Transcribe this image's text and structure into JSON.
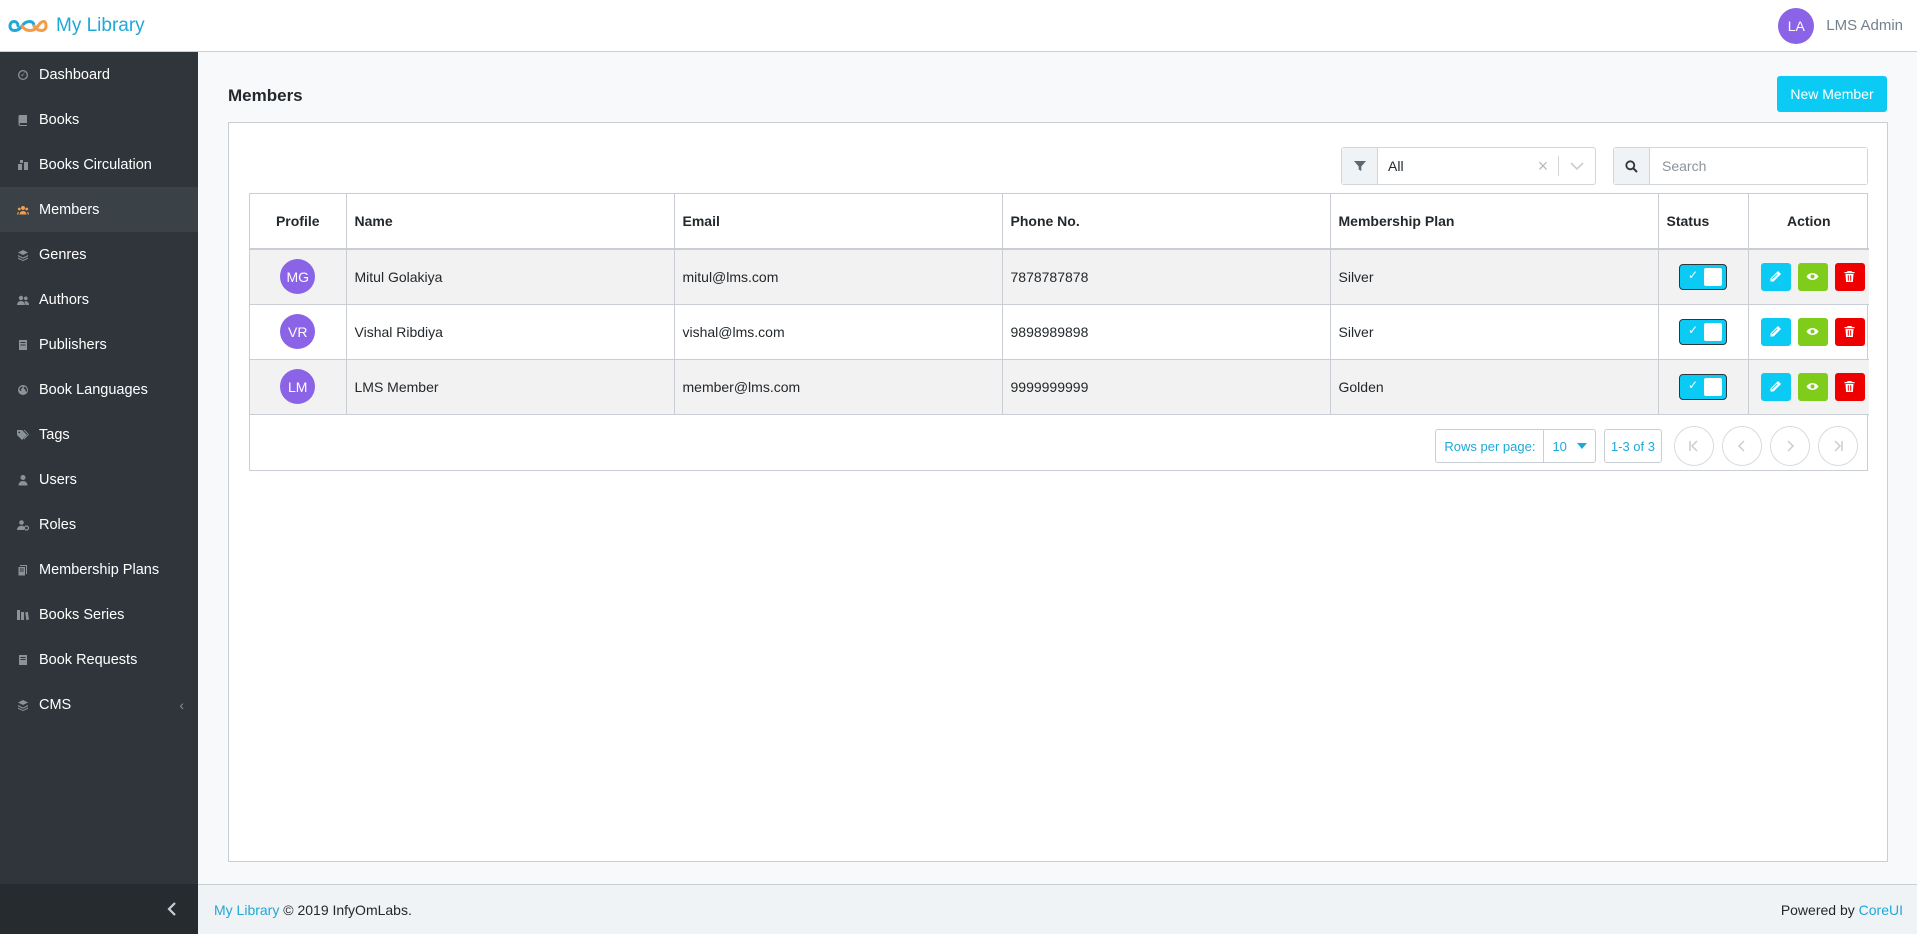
{
  "header": {
    "brand_name": "My Library",
    "logo_icon": "infinity-logo-icon",
    "user_initials": "LA",
    "user_name": "LMS Admin"
  },
  "sidebar": {
    "items": [
      {
        "label": "Dashboard",
        "icon": "speedometer-icon"
      },
      {
        "label": "Books",
        "icon": "book-icon"
      },
      {
        "label": "Books Circulation",
        "icon": "circulation-icon"
      },
      {
        "label": "Members",
        "icon": "users-group-icon"
      },
      {
        "label": "Genres",
        "icon": "layers-icon"
      },
      {
        "label": "Authors",
        "icon": "user-friends-icon"
      },
      {
        "label": "Publishers",
        "icon": "book-stack-icon"
      },
      {
        "label": "Book Languages",
        "icon": "globe-icon"
      },
      {
        "label": "Tags",
        "icon": "tags-icon"
      },
      {
        "label": "Users",
        "icon": "user-icon"
      },
      {
        "label": "Roles",
        "icon": "user-cog-icon"
      },
      {
        "label": "Membership Plans",
        "icon": "clipboard-icon"
      },
      {
        "label": "Books Series",
        "icon": "series-icon"
      },
      {
        "label": "Book Requests",
        "icon": "book-request-icon"
      },
      {
        "label": "CMS",
        "icon": "cms-layers-icon"
      }
    ],
    "active": "Members",
    "cms_caret": "‹",
    "minimizer_icon": "chevron-left-icon"
  },
  "main": {
    "title": "Members",
    "new_button": "New Member",
    "filter": {
      "value": "All",
      "clear": "×"
    },
    "search": {
      "placeholder": "Search"
    },
    "table": {
      "headers": [
        "Profile",
        "Name",
        "Email",
        "Phone No.",
        "Membership Plan",
        "Status",
        "Action"
      ],
      "rows": [
        {
          "initials": "MG",
          "name": "Mitul Golakiya",
          "email": "mitul@lms.com",
          "phone": "7878787878",
          "plan": "Silver",
          "status_on": true
        },
        {
          "initials": "VR",
          "name": "Vishal Ribdiya",
          "email": "vishal@lms.com",
          "phone": "9898989898",
          "plan": "Silver",
          "status_on": true
        },
        {
          "initials": "LM",
          "name": "LMS Member",
          "email": "member@lms.com",
          "phone": "9999999999",
          "plan": "Golden",
          "status_on": true
        }
      ]
    },
    "pagination": {
      "rows_per_page_label": "Rows per page:",
      "rows_per_page": "10",
      "range": "1-3 of 3"
    }
  },
  "footer": {
    "brand_link": "My Library",
    "copyright": "© 2019 InfyOmLabs.",
    "powered_by": "Powered by",
    "powered_link": "CoreUI"
  },
  "colors": {
    "accent": "#20a8d8",
    "button_primary": "#0bcbf5",
    "avatar": "#8a63e6",
    "view": "#7fcc1a",
    "delete": "#ee0000",
    "sidebar_bg": "#2f353a"
  }
}
